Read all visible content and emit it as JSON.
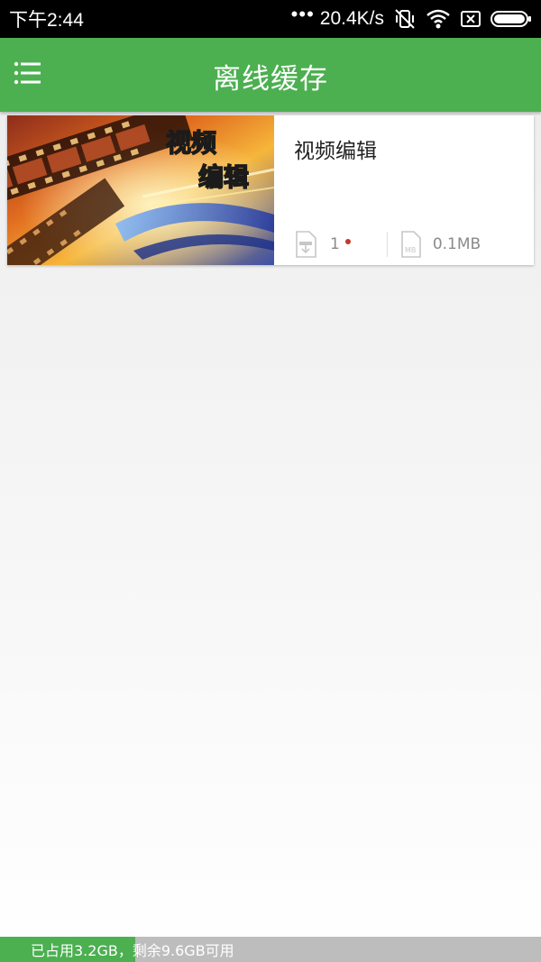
{
  "status_bar": {
    "time": "下午2:44",
    "speed": "20.4K/s",
    "icons": [
      "more-dots-icon",
      "mute-vibrate-icon",
      "wifi-icon",
      "sim-x-icon",
      "battery-icon"
    ]
  },
  "app_bar": {
    "title": "离线缓存",
    "menu_icon": "menu-list-icon"
  },
  "cache_items": [
    {
      "title": "视频编辑",
      "thumbnail_text": [
        "视频",
        "编辑"
      ],
      "count": "1",
      "size": "0.1MB",
      "has_new": true
    }
  ],
  "storage": {
    "used_text": "已占用3.2GB",
    "separator": "，",
    "free_text": "剩余9.6GB可用",
    "used_fraction": 0.25
  },
  "colors": {
    "accent": "#4caf50",
    "storage_remaining": "#bdbdbd",
    "new_dot": "#c0392b"
  }
}
